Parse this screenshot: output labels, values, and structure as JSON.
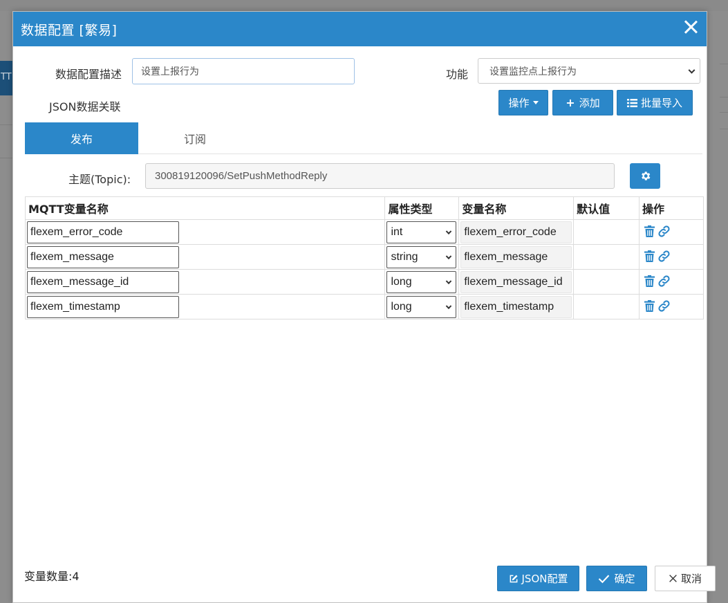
{
  "backdrop": {
    "left_button_text": "TT"
  },
  "dialog": {
    "title": "数据配置 [繁易]",
    "description_label": "数据配置描述",
    "description_placeholder": "设置上报行为",
    "function_label": "功能",
    "function_value": "设置监控点上报行为",
    "json_label": "JSON数据关联",
    "buttons": {
      "operate": "操作",
      "add": "添加",
      "batch_import": "批量导入"
    },
    "tabs": [
      {
        "label": "发布",
        "active": true
      },
      {
        "label": "订阅",
        "active": false
      }
    ],
    "topic_label": "主题(Topic):",
    "topic_value": "300819120096/SetPushMethodReply",
    "table": {
      "headers": [
        "MQTT变量名称",
        "属性类型",
        "变量名称",
        "默认值",
        "操作"
      ],
      "rows": [
        {
          "mqtt_name": "flexem_error_code",
          "type": "int",
          "var_name": "flexem_error_code",
          "default": ""
        },
        {
          "mqtt_name": "flexem_message",
          "type": "string",
          "var_name": "flexem_message",
          "default": ""
        },
        {
          "mqtt_name": "flexem_message_id",
          "type": "long",
          "var_name": "flexem_message_id",
          "default": ""
        },
        {
          "mqtt_name": "flexem_timestamp",
          "type": "long",
          "var_name": "flexem_timestamp",
          "default": ""
        }
      ]
    },
    "variable_count": "变量数量:4",
    "footer": {
      "json_config": "JSON配置",
      "confirm": "确定",
      "cancel": "取消"
    },
    "icons": {
      "close": "close-icon",
      "gear": "gear-icon",
      "delete": "trash-icon",
      "link": "link-icon",
      "add": "plus-icon",
      "list": "list-icon",
      "edit": "edit-icon",
      "check": "check-icon"
    },
    "colors": {
      "primary": "#2b87c9",
      "header": "#2b87c9"
    }
  }
}
